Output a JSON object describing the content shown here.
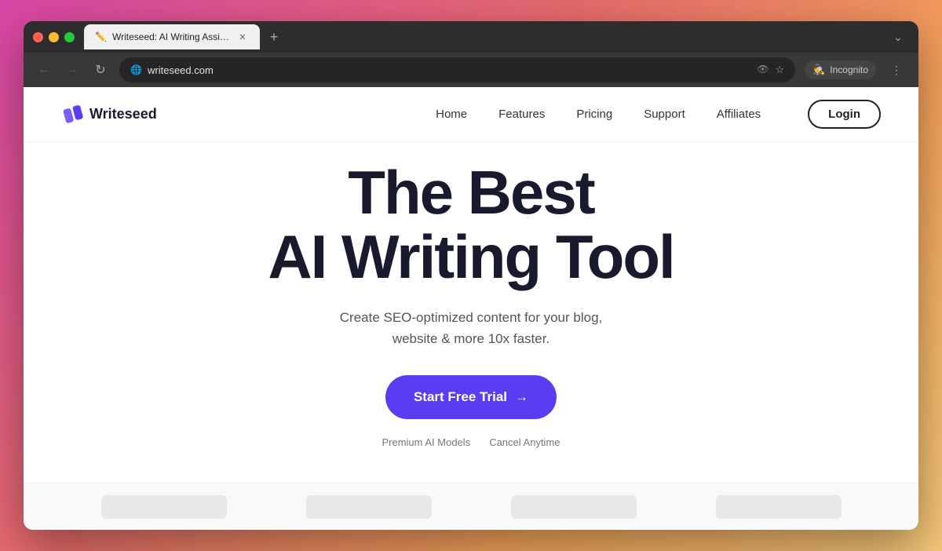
{
  "browser": {
    "traffic_lights": [
      "red",
      "yellow",
      "green"
    ],
    "tab": {
      "title": "Writeseed: AI Writing Assista...",
      "favicon": "✏️"
    },
    "new_tab_label": "+",
    "url": "writeseed.com",
    "nav": {
      "back": "←",
      "forward": "→",
      "refresh": "↻"
    },
    "incognito_label": "Incognito",
    "menu_label": "⋮",
    "chevron_label": "⌄"
  },
  "website": {
    "logo_text": "Writeseed",
    "nav_links": [
      {
        "label": "Home",
        "href": "#"
      },
      {
        "label": "Features",
        "href": "#"
      },
      {
        "label": "Pricing",
        "href": "#"
      },
      {
        "label": "Support",
        "href": "#"
      },
      {
        "label": "Affiliates",
        "href": "#"
      }
    ],
    "login_label": "Login",
    "hero": {
      "title_line1": "The Best",
      "title_line2": "AI Writing Tool",
      "subtitle_line1": "Create SEO-optimized content for your blog,",
      "subtitle_line2": "website & more 10x faster.",
      "cta_label": "Start Free Trial",
      "cta_arrow": "→",
      "badge1": "Premium AI Models",
      "badge2": "Cancel Anytime"
    }
  }
}
